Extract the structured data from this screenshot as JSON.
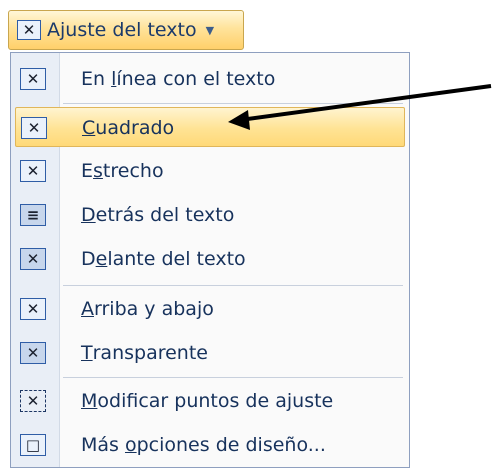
{
  "ribbon_button": {
    "label": "Ajuste del texto",
    "icon": "text-wrap-icon",
    "dropdown_icon": "chevron-down-icon"
  },
  "menu": {
    "items": [
      {
        "pre": "En ",
        "mn": "l",
        "post": "ínea con el texto",
        "icon": "inline-with-text-icon",
        "selected": false
      },
      {
        "pre": "",
        "mn": "C",
        "post": "uadrado",
        "icon": "square-wrap-icon",
        "selected": true
      },
      {
        "pre": "E",
        "mn": "s",
        "post": "trecho",
        "icon": "tight-wrap-icon",
        "selected": false
      },
      {
        "pre": "",
        "mn": "D",
        "post": "etrás del texto",
        "icon": "behind-text-icon",
        "selected": false
      },
      {
        "pre": "D",
        "mn": "e",
        "post": "lante del texto",
        "icon": "in-front-of-text-icon",
        "selected": false
      },
      {
        "pre": "",
        "mn": "A",
        "post": "rriba y abajo",
        "icon": "top-and-bottom-icon",
        "selected": false
      },
      {
        "pre": "",
        "mn": "T",
        "post": "ransparente",
        "icon": "through-wrap-icon",
        "selected": false
      },
      {
        "pre": "",
        "mn": "M",
        "post": "odificar puntos de ajuste",
        "icon": "edit-wrap-points-icon",
        "selected": false
      },
      {
        "pre": "Más ",
        "mn": "o",
        "post": "pciones de diseño...",
        "icon": "more-layout-options-icon",
        "selected": false
      }
    ]
  },
  "colors": {
    "highlight": "#ffe394",
    "menu_border": "#8e9fbf",
    "text": "#17325c"
  }
}
